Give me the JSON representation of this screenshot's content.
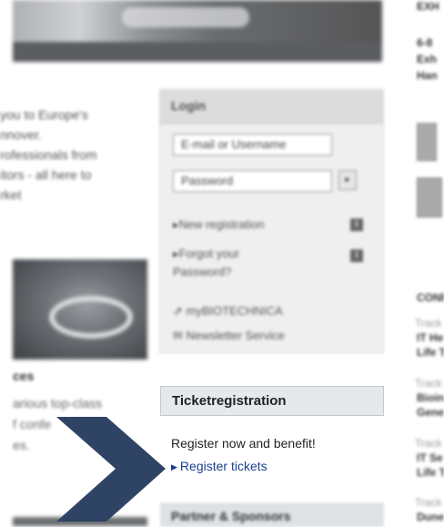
{
  "left": {
    "intro_lines": [
      "you to Europe's",
      "nnover.",
      "rofessionals from",
      "itors - all here to",
      "rket"
    ],
    "conference_heading": "ces",
    "conference_lines": [
      "arious top-class",
      "f confe",
      "es."
    ]
  },
  "login": {
    "title": "Login",
    "username_placeholder": "E-mail or Username",
    "password_placeholder": "Password",
    "go_symbol": "▸",
    "new_registration": "▸New registration",
    "forgot_password_line1": "▸Forgot your",
    "forgot_password_line2": "Password?",
    "info_symbol": "i",
    "my_portal": "myBIOTECHNICA",
    "newsletter": "Newsletter Service"
  },
  "ticket": {
    "title": "Ticketregistration",
    "tagline": "Register now and benefit!",
    "link_label": "Register tickets"
  },
  "partner": {
    "title": "Partner & Sponsors"
  },
  "right": {
    "top_label": "EXH",
    "date_line": "6-8",
    "line2": "Exh",
    "line3": "Han",
    "conf_label": "CONF",
    "items": [
      {
        "small": "Track",
        "bold1": "IT He",
        "bold2": "Life T"
      },
      {
        "small": "Track",
        "bold1": "Bioin",
        "bold2": "Gene"
      },
      {
        "small": "Track",
        "bold1": "IT Se",
        "bold2": "Life T"
      },
      {
        "small": "Track",
        "bold1": "Dune",
        "bold2": ""
      }
    ]
  },
  "colors": {
    "arrow": "#2f4465",
    "link": "#1a3f8f"
  }
}
